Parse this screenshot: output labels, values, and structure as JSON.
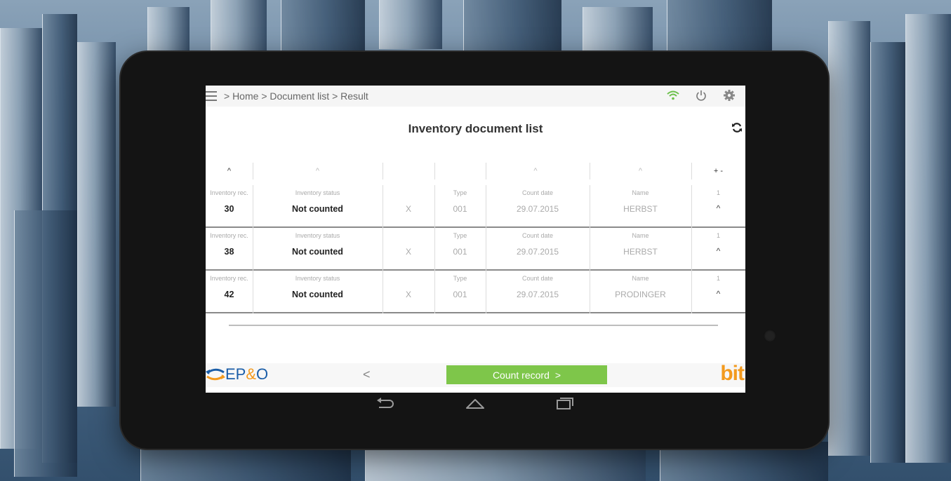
{
  "breadcrumb": {
    "items": [
      "> Home",
      "> Document list",
      "> Result"
    ]
  },
  "page": {
    "title": "Inventory document list"
  },
  "columns": {
    "sort_marks": [
      "^",
      "^",
      "^",
      "^",
      "+ -"
    ],
    "labels": [
      "Inventory rec.",
      "Inventory status",
      "Type",
      "Count date",
      "Name"
    ]
  },
  "rows": [
    {
      "inventory_rec": "30",
      "status": "Not counted",
      "flag": "X",
      "type": "001",
      "count_date": "29.07.2015",
      "name": "HERBST",
      "count": "1",
      "expand": "^"
    },
    {
      "inventory_rec": "38",
      "status": "Not counted",
      "flag": "X",
      "type": "001",
      "count_date": "29.07.2015",
      "name": "HERBST",
      "count": "1",
      "expand": "^"
    },
    {
      "inventory_rec": "42",
      "status": "Not counted",
      "flag": "X",
      "type": "001",
      "count_date": "29.07.2015",
      "name": "PRODINGER",
      "count": "1",
      "expand": "^"
    }
  ],
  "footer": {
    "logo_left": "EP",
    "logo_amp": "&",
    "logo_right": "O",
    "prev_label": "<",
    "count_record_label": "Count record",
    "count_record_arrow": ">",
    "brand_right": "bit"
  },
  "icons": {
    "menu": "menu-icon",
    "wifi": "wifi-icon",
    "power": "power-icon",
    "settings": "gear-icon",
    "refresh": "refresh-icon",
    "back": "back-icon",
    "home": "home-icon",
    "recents": "recents-icon"
  },
  "colors": {
    "accent_green": "#7ec64a",
    "wifi_green": "#6cc04a",
    "brand_blue": "#1b5ea8",
    "brand_orange": "#f39a1e"
  }
}
